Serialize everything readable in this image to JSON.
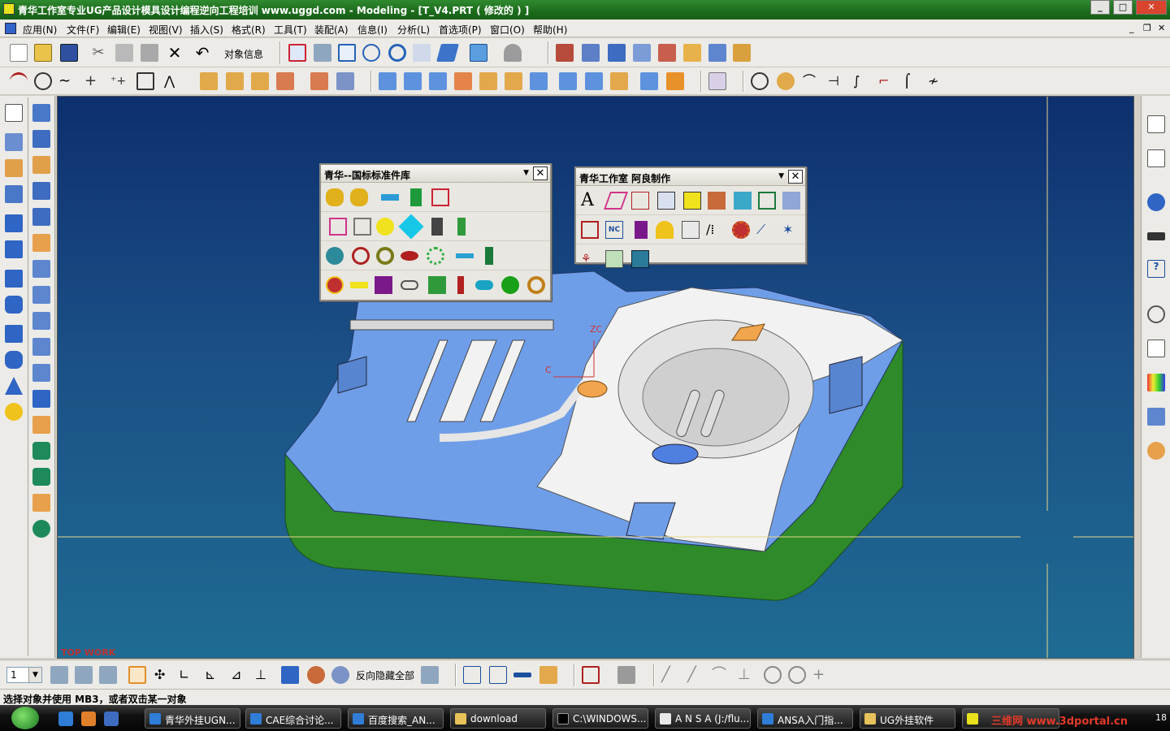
{
  "window": {
    "title": "青华工作室专业UG产品设计模具设计编程逆向工程培训 www.uggd.com - Modeling - [T_V4.PRT ( 修改的 ) ]",
    "controls": [
      "_",
      "□",
      "✕"
    ]
  },
  "menu": {
    "items": [
      "应用(N)",
      "文件(F)",
      "编辑(E)",
      "视图(V)",
      "插入(S)",
      "格式(R)",
      "工具(T)",
      "装配(A)",
      "信息(I)",
      "分析(L)",
      "首选项(P)",
      "窗口(O)",
      "帮助(H)"
    ],
    "mdi_controls": [
      "_",
      "❐",
      "✕"
    ]
  },
  "toolbar": {
    "object_info_label": "对象信息",
    "reverse_hide_all_label": "反向隐藏全部",
    "layer_value": "1"
  },
  "palette_standard": {
    "title": "青华--国标标准件库"
  },
  "palette_aliang": {
    "title": "青华工作室 阿良制作",
    "text_tool_glyph": "A",
    "nc_label": "NC"
  },
  "viewport": {
    "axis_zc": "ZC",
    "axis_c": "C",
    "watermark": "TOP WORK"
  },
  "status": {
    "prompt": "选择对象并使用 MB3，或者双击某一对象"
  },
  "taskbar": {
    "tasks": [
      "青华外挂UGN...",
      "CAE综合讨论...",
      "百度搜索_AN...",
      "download",
      "C:\\WINDOWS...",
      "A N S A (J:/flu...",
      "ANSA入门指...",
      "UG外挂软件"
    ],
    "overlay_text": "三维网 www.3dportal.cn",
    "clock_fragment": "18"
  },
  "colors": {
    "title_green": "#1c6b1c",
    "viewport_top": "#0d2f6e",
    "viewport_bottom": "#1e6c93",
    "part_green": "#2f8a2a",
    "part_blue": "#6f9ee8",
    "part_white": "#f2f2f2"
  }
}
